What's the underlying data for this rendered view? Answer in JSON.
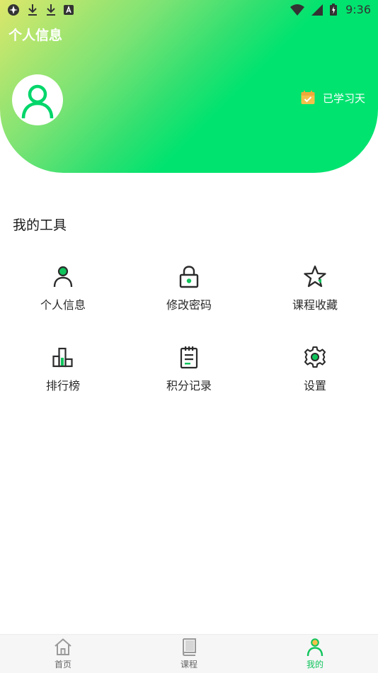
{
  "status_bar": {
    "time": "9:36",
    "left_icons": [
      "settings-gear-icon",
      "download-icon",
      "download-icon",
      "keyboard-a-icon"
    ],
    "right_icons": [
      "wifi-icon",
      "signal-icon",
      "battery-icon"
    ]
  },
  "header": {
    "title": "个人信息",
    "avatar_icon": "user-icon",
    "study_days_label": "已学习天",
    "study_days_icon": "calendar-check-icon",
    "gradient_colors": [
      "#dde76b",
      "#00e36f"
    ]
  },
  "tools": {
    "title": "我的工具",
    "items": [
      {
        "label": "个人信息",
        "icon": "person-icon"
      },
      {
        "label": "修改密码",
        "icon": "lock-icon"
      },
      {
        "label": "课程收藏",
        "icon": "star-icon"
      },
      {
        "label": "排行榜",
        "icon": "leaderboard-icon"
      },
      {
        "label": "积分记录",
        "icon": "clipboard-icon"
      },
      {
        "label": "设置",
        "icon": "gear-icon"
      }
    ]
  },
  "bottom_nav": {
    "items": [
      {
        "label": "首页",
        "icon": "home-icon",
        "active": false
      },
      {
        "label": "课程",
        "icon": "book-icon",
        "active": false
      },
      {
        "label": "我的",
        "icon": "person-icon",
        "active": true
      }
    ]
  },
  "colors": {
    "accent": "#10c45c",
    "icon_dark": "#2b2b2b",
    "calendar": "#f5c04a"
  }
}
